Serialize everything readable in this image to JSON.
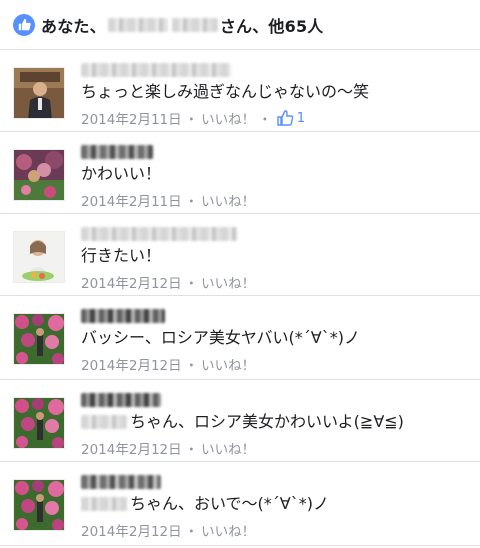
{
  "header": {
    "prefix": "あなた、",
    "suffix": "さん、他65人"
  },
  "comments": [
    {
      "text": "ちょっと楽しみ過ぎなんじゃないの〜笑",
      "date": "2014年2月11日",
      "dot": "・",
      "like_label": "いいね！",
      "extra_dot": "・",
      "like_count": "1"
    },
    {
      "text": "かわいい！",
      "date": "2014年2月11日",
      "dot": "・",
      "like_label": "いいね！"
    },
    {
      "text": "行きたい！",
      "date": "2014年2月12日",
      "dot": "・",
      "like_label": "いいね！"
    },
    {
      "text": "バッシー、ロシア美女ヤバい(*´∀`*)ノ",
      "date": "2014年2月12日",
      "dot": "・",
      "like_label": "いいね！"
    },
    {
      "text": "ちゃん、ロシア美女かわいいよ(≧∀≦)",
      "date": "2014年2月12日",
      "dot": "・",
      "like_label": "いいね！"
    },
    {
      "text": "ちゃん、おいで〜(*´∀`*)ノ",
      "date": "2014年2月12日",
      "dot": "・",
      "like_label": "いいね！"
    }
  ],
  "colors": {
    "accent": "#5890ff",
    "meta": "#90949c",
    "text": "#1c1e21",
    "divider": "#dddfe2"
  },
  "icons": {
    "header": "like-badge-icon",
    "reaction": "thumbs-up-icon"
  }
}
